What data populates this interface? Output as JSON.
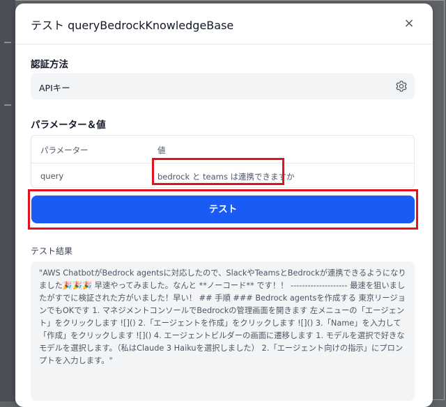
{
  "modal": {
    "title": "テスト queryBedrockKnowledgeBase",
    "close_symbol": "×"
  },
  "auth": {
    "label": "認証方法",
    "value": "APIキー",
    "settings_icon": "gear-icon"
  },
  "params": {
    "label": "パラメーター＆値",
    "headers": [
      "パラメーター",
      "値"
    ],
    "rows": [
      {
        "name": "query",
        "value": "bedrock と teams は連携できますか"
      }
    ]
  },
  "test_button": {
    "label": "テスト"
  },
  "result": {
    "label": "テスト結果",
    "text": "\"AWS ChatbotがBedrock agentsに対応したので、SlackやTeamsとBedrockが連携できるようになりました🎉🎉🎉 早速やってみました。なんと **ノーコード** です！！ -------------------- 最速を狙いましたがすでに検証された方がいました！早い！ ## 手順 ### Bedrock agentsを作成する 東京リージョンでもOKです 1. マネジメントコンソールでBedrockの管理画面を開きます 左メニューの「エージェント」をクリックします ![]() 2.「エージェントを作成」をクリックします ![]() 3.「Name」を入力して「作成」をクリックします ![]() 4. エージェントビルダーの画面に遷移します 1. モデルを選択で好きなモデルを選択します。（私はClaude 3 Haikuを選択しました） 2.「エージェント向けの指示」にプロンプトを入力します。\""
  },
  "colors": {
    "primary": "#1a5af5",
    "highlight": "#e3101f",
    "field_bg": "#f3f4f6"
  }
}
